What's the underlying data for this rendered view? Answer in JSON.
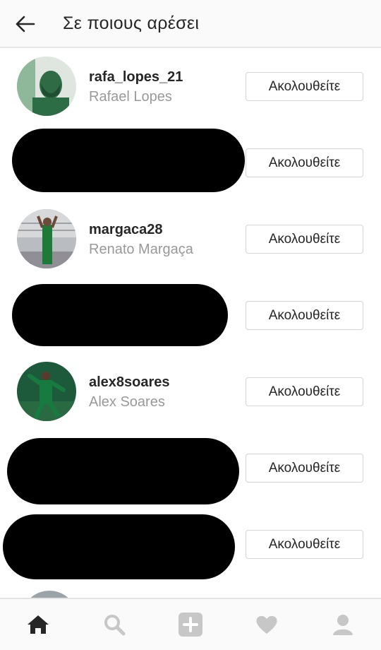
{
  "header": {
    "title": "Σε ποιους αρέσει",
    "back_icon": "arrow-left-icon"
  },
  "users": [
    {
      "username": "rafa_lopes_21",
      "full_name": "Rafael Lopes",
      "button": "Ακολουθείτε",
      "redacted": false
    },
    {
      "username": "",
      "full_name": "",
      "button": "Ακολουθείτε",
      "redacted": true
    },
    {
      "username": "margaca28",
      "full_name": "Renato Margaça",
      "button": "Ακολουθείτε",
      "redacted": false
    },
    {
      "username": "",
      "full_name": "",
      "button": "Ακολουθείτε",
      "redacted": true
    },
    {
      "username": "alex8soares",
      "full_name": "Alex Soares",
      "button": "Ακολουθείτε",
      "redacted": false
    },
    {
      "username": "",
      "full_name": "",
      "button": "Ακολουθείτε",
      "redacted": true
    },
    {
      "username": "",
      "full_name": "",
      "button": "Ακολουθείτε",
      "redacted": true
    }
  ],
  "bottom_nav": {
    "items": [
      "home-icon",
      "search-icon",
      "add-post-icon",
      "heart-icon",
      "profile-icon"
    ],
    "active": "home-icon",
    "active_color": "#262626",
    "inactive_color": "#c7c7c7"
  }
}
